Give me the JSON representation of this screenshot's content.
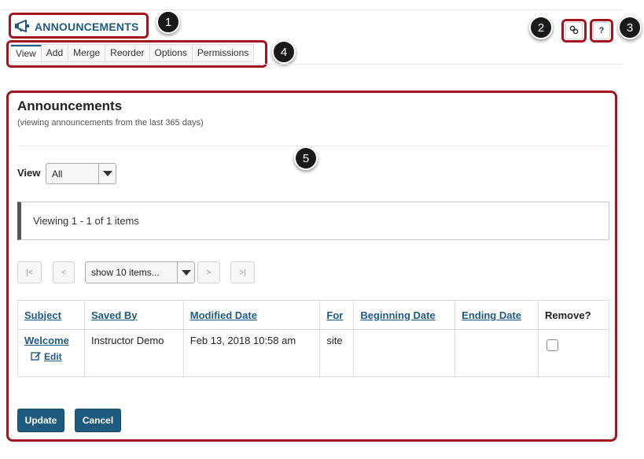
{
  "tool": {
    "title": "ANNOUNCEMENTS",
    "icon": "megaphone-icon"
  },
  "toolbar": {
    "link_icon": "link-icon",
    "help_label": "?"
  },
  "nav": {
    "items": [
      "View",
      "Add",
      "Merge",
      "Reorder",
      "Options",
      "Permissions"
    ],
    "active": "View"
  },
  "page": {
    "title": "Announcements",
    "subtitle": "(viewing announcements from the last 365 days)"
  },
  "view_filter": {
    "label": "View",
    "selected": "All"
  },
  "viewing_status": "Viewing 1 - 1 of 1 items",
  "pager": {
    "first": "|<",
    "prev": "<",
    "page_size": "show 10 items...",
    "next": ">",
    "last": ">|"
  },
  "table": {
    "headers": [
      "Subject",
      "Saved By",
      "Modified Date",
      "For",
      "Beginning Date",
      "Ending Date",
      "Remove?"
    ],
    "rows": [
      {
        "subject": "Welcome",
        "edit_label": "Edit",
        "saved_by": "Instructor Demo",
        "modified_date": "Feb 13, 2018 10:58 am",
        "for": "site",
        "beginning_date": "",
        "ending_date": "",
        "remove_checked": false
      }
    ]
  },
  "actions": {
    "update": "Update",
    "cancel": "Cancel"
  },
  "callouts": [
    "1",
    "2",
    "3",
    "4",
    "5"
  ],
  "colors": {
    "highlight": "#a4161e",
    "accent": "#1e5a84",
    "button": "#1d5a7e"
  }
}
